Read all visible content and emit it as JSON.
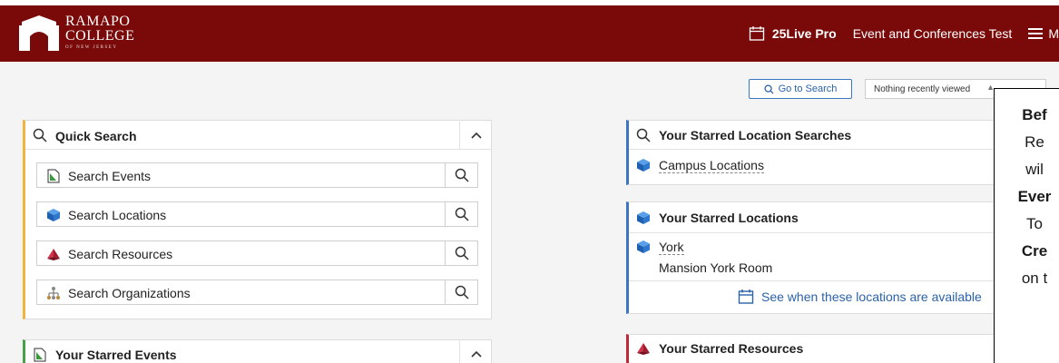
{
  "header": {
    "logo": {
      "line1": "RAMAPO",
      "line2": "COLLEGE",
      "line3": "OF NEW JERSEY"
    },
    "brand": "25Live Pro",
    "user": "Event and Conferences Test",
    "menu_label": "M"
  },
  "toolbar": {
    "goto_search": "Go to Search",
    "recent": "Nothing recently viewed"
  },
  "quick_search": {
    "title": "Quick Search",
    "rows": [
      {
        "label": "Search Events",
        "icon": "event-icon"
      },
      {
        "label": "Search Locations",
        "icon": "location-icon"
      },
      {
        "label": "Search Resources",
        "icon": "resource-icon"
      },
      {
        "label": "Search Organizations",
        "icon": "organization-icon"
      }
    ]
  },
  "starred_events": {
    "title": "Your Starred Events"
  },
  "starred_location_searches": {
    "title": "Your Starred Location Searches",
    "items": [
      "Campus Locations"
    ]
  },
  "starred_locations": {
    "title": "Your Starred Locations",
    "items": [
      {
        "name": "York",
        "formal": "Mansion York Room"
      }
    ],
    "availability_link": "See when these locations are available"
  },
  "starred_resources": {
    "title": "Your Starred Resources"
  },
  "overlay_text": {
    "line1": "Bef",
    "line2": "Re",
    "line3": "wil",
    "line4": "Ever",
    "line5": "To",
    "line6": "Cre",
    "line7": "on t"
  },
  "colors": {
    "header_bg": "#7a0a0a",
    "accent_yellow": "#f0b53a",
    "accent_green": "#4aa04a",
    "accent_blue": "#3a76c2",
    "accent_red": "#c0283a"
  }
}
